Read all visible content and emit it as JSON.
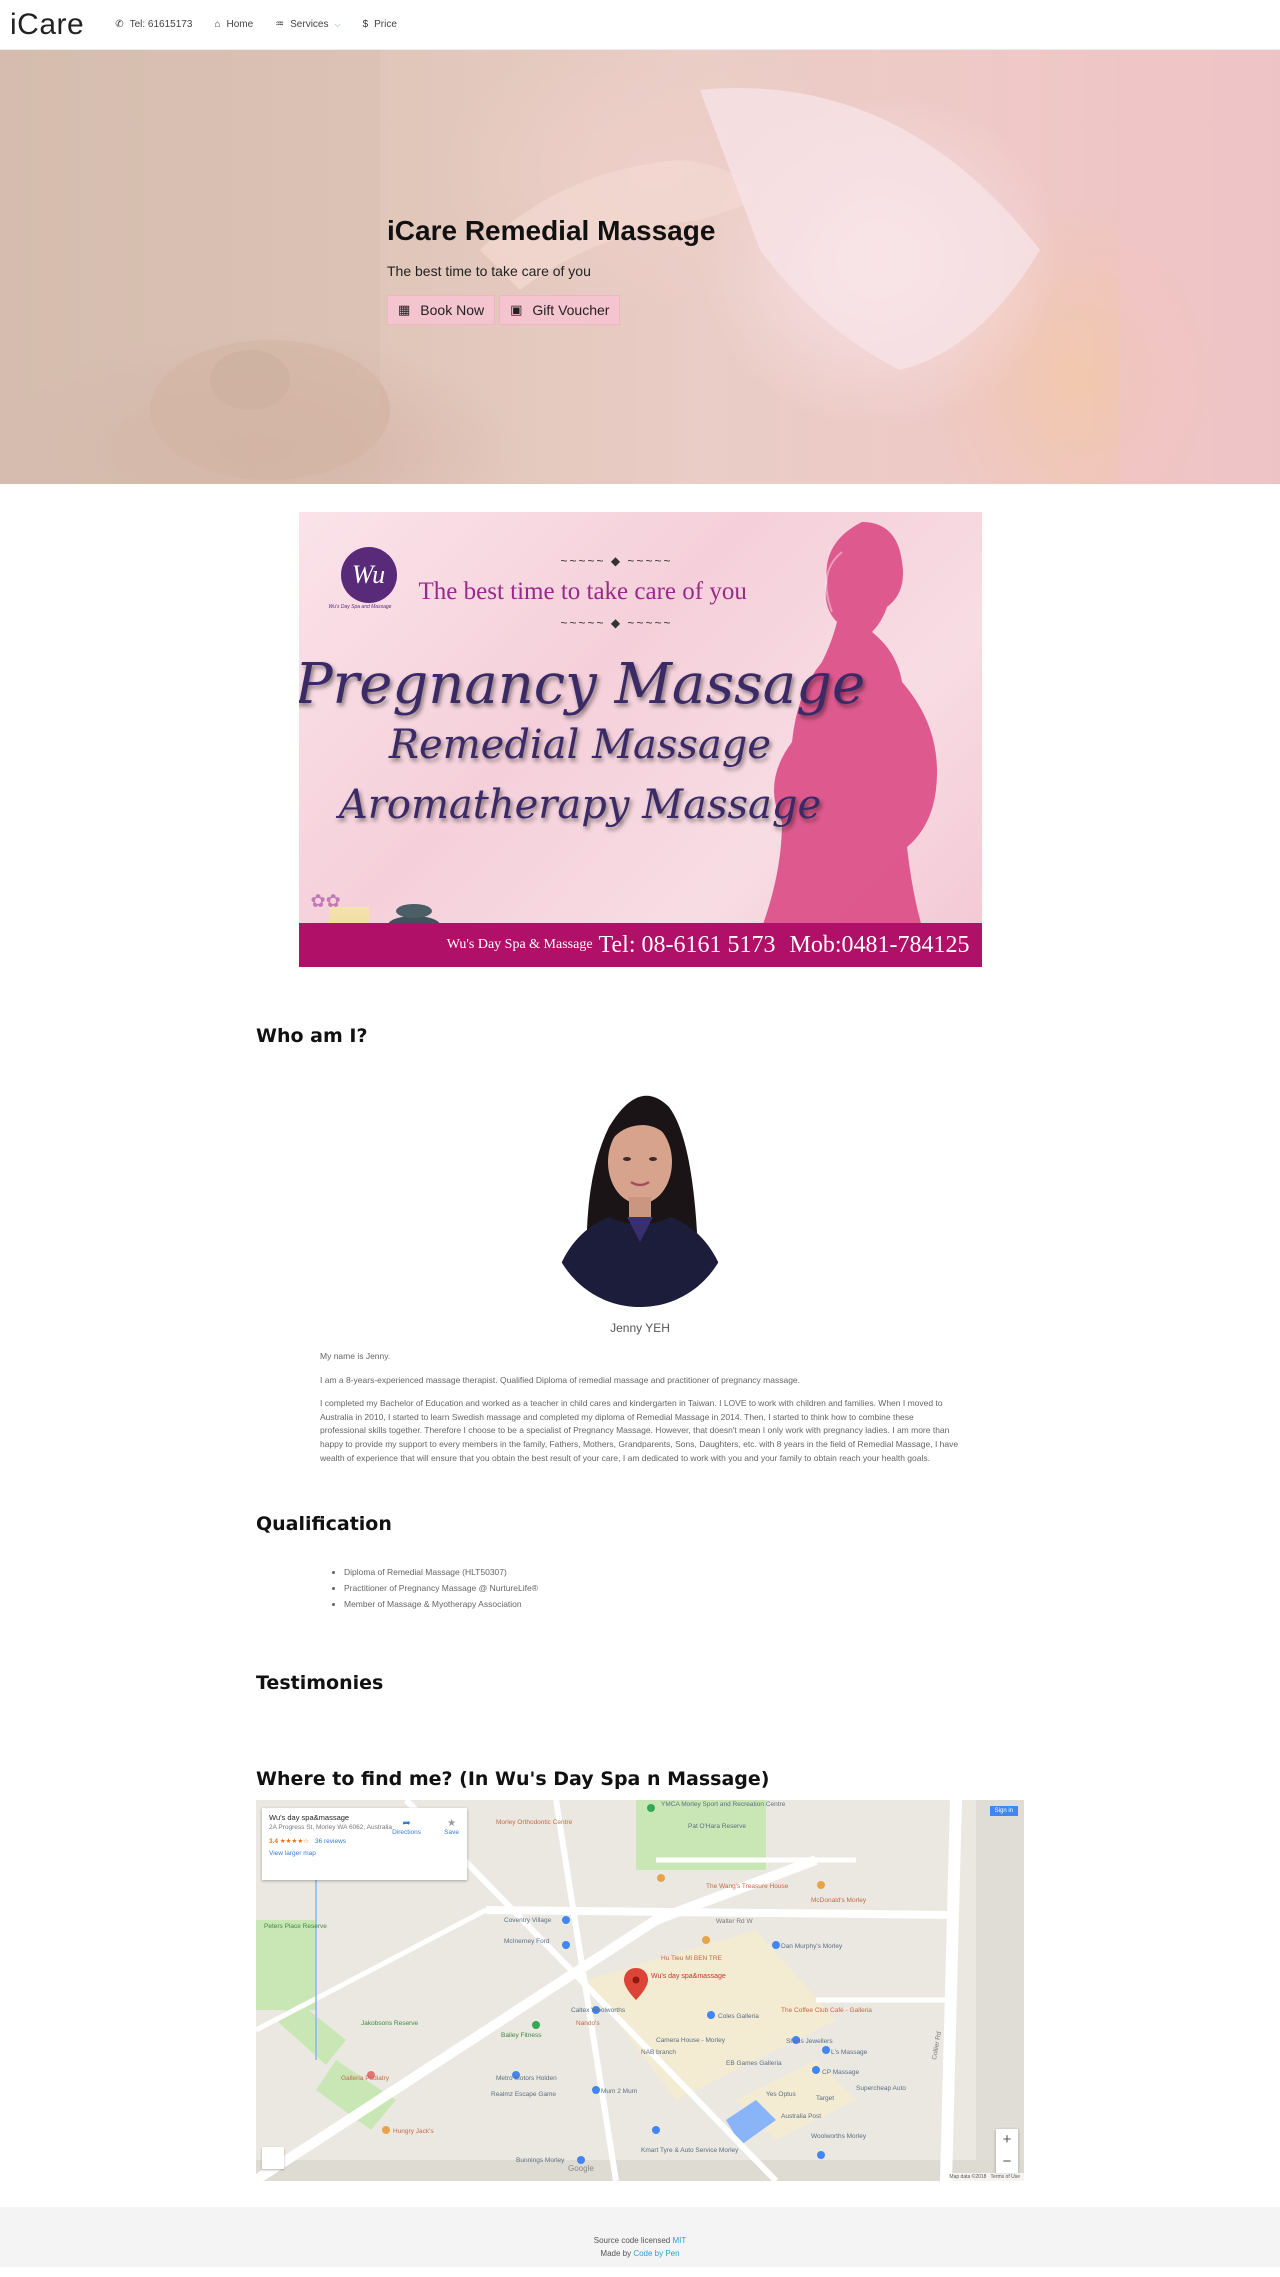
{
  "nav": {
    "brand": "iCare",
    "items": [
      {
        "icon": "phone-icon",
        "glyph": "✆",
        "label": "Tel: 61615173"
      },
      {
        "icon": "home-icon",
        "glyph": "⌂",
        "label": "Home"
      },
      {
        "icon": "services-icon",
        "glyph": "♒",
        "label": "Services"
      },
      {
        "icon": "dollar-icon",
        "glyph": "$",
        "label": "Price"
      }
    ]
  },
  "hero": {
    "title": "iCare Remedial Massage",
    "subtitle": "The best time to take care of you",
    "book_label": "Book Now",
    "voucher_label": "Gift Voucher"
  },
  "banner": {
    "logo_text": "Wu",
    "logo_sub": "Wu's Day Spa and Massage",
    "tagline": "The best time to take care of you",
    "line1": "Pregnancy Massage",
    "line2": "Remedial Massage",
    "line3": "Aromatherapy Massage",
    "spa": "Wu's Day Spa & Massage",
    "tel": "Tel: 08-6161 5173",
    "mob": "Mob:0481-784125"
  },
  "who": {
    "heading": "Who am I?",
    "caption": "Jenny YEH",
    "p1": "My name is Jenny.",
    "p2": "I am a 8-years-experienced massage therapist. Qualified Diploma of remedial massage and practitioner of pregnancy massage.",
    "p3": "I completed my Bachelor of Education and worked as a teacher in child cares and kindergarten in Taiwan. I LOVE to work with children and families. When I moved to Australia in 2010, I started to learn Swedish massage and completed my diploma of Remedial Massage in 2014. Then, I started to think how to combine these professional skills together. Therefore I choose to be a specialist of Pregnancy Massage. However, that doesn't mean I only work with pregnancy ladies. I am more than happy to provide my support to every members in the family, Fathers, Mothers, Grandparents, Sons, Daughters, etc. with 8 years in the field of Remedial Massage, I have wealth of experience that will ensure that you obtain the best result of your care, I am dedicated to work with you and your family to obtain reach your health goals."
  },
  "qualification": {
    "heading": "Qualification",
    "items": [
      "Diploma of Remedial Massage (HLT50307)",
      "Practitioner of Pregnancy Massage @ NurtureLife®",
      "Member of Massage & Myotherapy Association"
    ]
  },
  "testimonies": {
    "heading": "Testimonies"
  },
  "find": {
    "heading": "Where to find me? (In Wu's Day Spa n Massage)",
    "map": {
      "place_name": "Wu's day spa&massage",
      "address": "2A Progress St, Morley WA 6062, Australia",
      "rating": "3.4 ★★★★☆",
      "reviews": "36 reviews",
      "view_larger": "View larger map",
      "directions": "Directions",
      "save": "Save",
      "sign_in": "Sign in",
      "pin_label": "Wu's day spa&massage",
      "google": "Google",
      "map_data": "Map data ©2018",
      "terms": "Terms of Use",
      "zoom_in": "+",
      "zoom_out": "−",
      "labels": [
        "YMCA Morley Sport and Recreation Centre",
        "Pat O'Hara Reserve",
        "Morley Orthodontic Centre",
        "Coventry Village",
        "McInerney Ford",
        "Peters Place Reserve",
        "The Wang's Treasure House",
        "McDonald's Morley",
        "Walter Rd W",
        "Dan Murphy's Morley",
        "Hu Tieu Mi BEN TRE",
        "Caltex Woolworths",
        "Coles Galleria",
        "The Coffee Club Café - Galleria",
        "Jakobsons Reserve",
        "Bailey Fitness",
        "Camera House - Morley",
        "Shiels Jewellers",
        "L's Massage",
        "NAB branch",
        "EB Games Galleria",
        "CP Massage",
        "Galleria Podiatry",
        "Metro Motors Holden",
        "Supercheap Auto",
        "Realmz Escape Game",
        "Mum 2 Mum",
        "Yes Optus",
        "Target",
        "Australia Post",
        "Hungry Jack's",
        "Woolworths Morley",
        "Bunnings Morley",
        "Kmart Tyre & Auto Service Morley",
        "Nando's",
        "Collier Rd"
      ]
    }
  },
  "footer": {
    "line1_prefix": "Source code licensed ",
    "line1_link": "MIT",
    "line2_prefix": "Made by ",
    "line2_link": "Code by Pen"
  },
  "colors": {
    "hero_button": "#f4c4cf",
    "banner_footer": "#b01067",
    "link": "#2aa1d6",
    "map_pin": "#db4437"
  }
}
